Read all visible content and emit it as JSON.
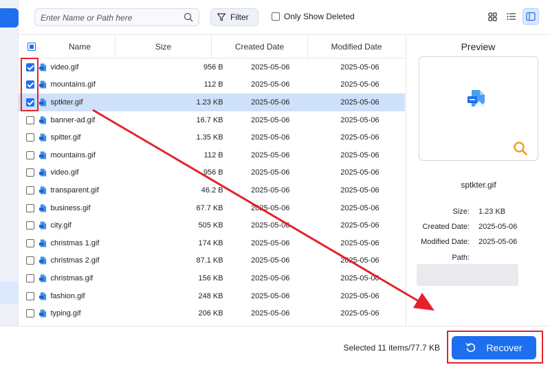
{
  "toolbar": {
    "search_placeholder": "Enter Name or Path here",
    "filter_label": "Filter",
    "only_show_deleted_label": "Only Show Deleted"
  },
  "table": {
    "headers": {
      "name": "Name",
      "size": "Size",
      "created": "Created Date",
      "modified": "Modified Date"
    },
    "rows": [
      {
        "name": "video.gif",
        "size": "956  B",
        "created": "2025-05-06",
        "modified": "2025-05-06",
        "checked": true,
        "selected": false
      },
      {
        "name": "mountains.gif",
        "size": "112  B",
        "created": "2025-05-06",
        "modified": "2025-05-06",
        "checked": true,
        "selected": false
      },
      {
        "name": "sptkter.gif",
        "size": "1.23 KB",
        "created": "2025-05-06",
        "modified": "2025-05-06",
        "checked": true,
        "selected": true
      },
      {
        "name": "banner-ad.gif",
        "size": "16.7 KB",
        "created": "2025-05-06",
        "modified": "2025-05-06",
        "checked": false,
        "selected": false
      },
      {
        "name": "spitter.gif",
        "size": "1.35 KB",
        "created": "2025-05-06",
        "modified": "2025-05-06",
        "checked": false,
        "selected": false
      },
      {
        "name": "mountains.gif",
        "size": "112  B",
        "created": "2025-05-06",
        "modified": "2025-05-06",
        "checked": false,
        "selected": false
      },
      {
        "name": "video.gif",
        "size": "956  B",
        "created": "2025-05-06",
        "modified": "2025-05-06",
        "checked": false,
        "selected": false
      },
      {
        "name": "transparent.gif",
        "size": "46.2  B",
        "created": "2025-05-06",
        "modified": "2025-05-06",
        "checked": false,
        "selected": false
      },
      {
        "name": "business.gif",
        "size": "67.7 KB",
        "created": "2025-05-06",
        "modified": "2025-05-06",
        "checked": false,
        "selected": false
      },
      {
        "name": "city.gif",
        "size": "505 KB",
        "created": "2025-05-06",
        "modified": "2025-05-06",
        "checked": false,
        "selected": false
      },
      {
        "name": "christmas 1.gif",
        "size": "174 KB",
        "created": "2025-05-06",
        "modified": "2025-05-06",
        "checked": false,
        "selected": false
      },
      {
        "name": "christmas 2.gif",
        "size": "87.1 KB",
        "created": "2025-05-06",
        "modified": "2025-05-06",
        "checked": false,
        "selected": false
      },
      {
        "name": "christmas.gif",
        "size": "156 KB",
        "created": "2025-05-06",
        "modified": "2025-05-06",
        "checked": false,
        "selected": false
      },
      {
        "name": "fashion.gif",
        "size": "248 KB",
        "created": "2025-05-06",
        "modified": "2025-05-06",
        "checked": false,
        "selected": false
      },
      {
        "name": "typing.gif",
        "size": "206 KB",
        "created": "2025-05-06",
        "modified": "2025-05-06",
        "checked": false,
        "selected": false
      }
    ]
  },
  "preview": {
    "title": "Preview",
    "file_name": "sptkter.gif",
    "size_label": "Size:",
    "size_value": "1.23 KB",
    "created_label": "Created Date:",
    "created_value": "2025-05-06",
    "modified_label": "Modified Date:",
    "modified_value": "2025-05-06",
    "path_label": "Path:"
  },
  "footer": {
    "selected_info": "Selected 11 items/77.7 KB",
    "recover_label": "Recover"
  },
  "colors": {
    "accent": "#1e6ff0",
    "selected_row": "#cfe0fb",
    "annotation": "#e3222a"
  },
  "icons": {
    "search": "magnifier-icon",
    "filter": "funnel-icon",
    "views": [
      "grid-view-icon",
      "list-view-icon",
      "preview-pane-icon"
    ],
    "file": "gif-file-icon",
    "recover": "rotate-arrow-icon"
  }
}
